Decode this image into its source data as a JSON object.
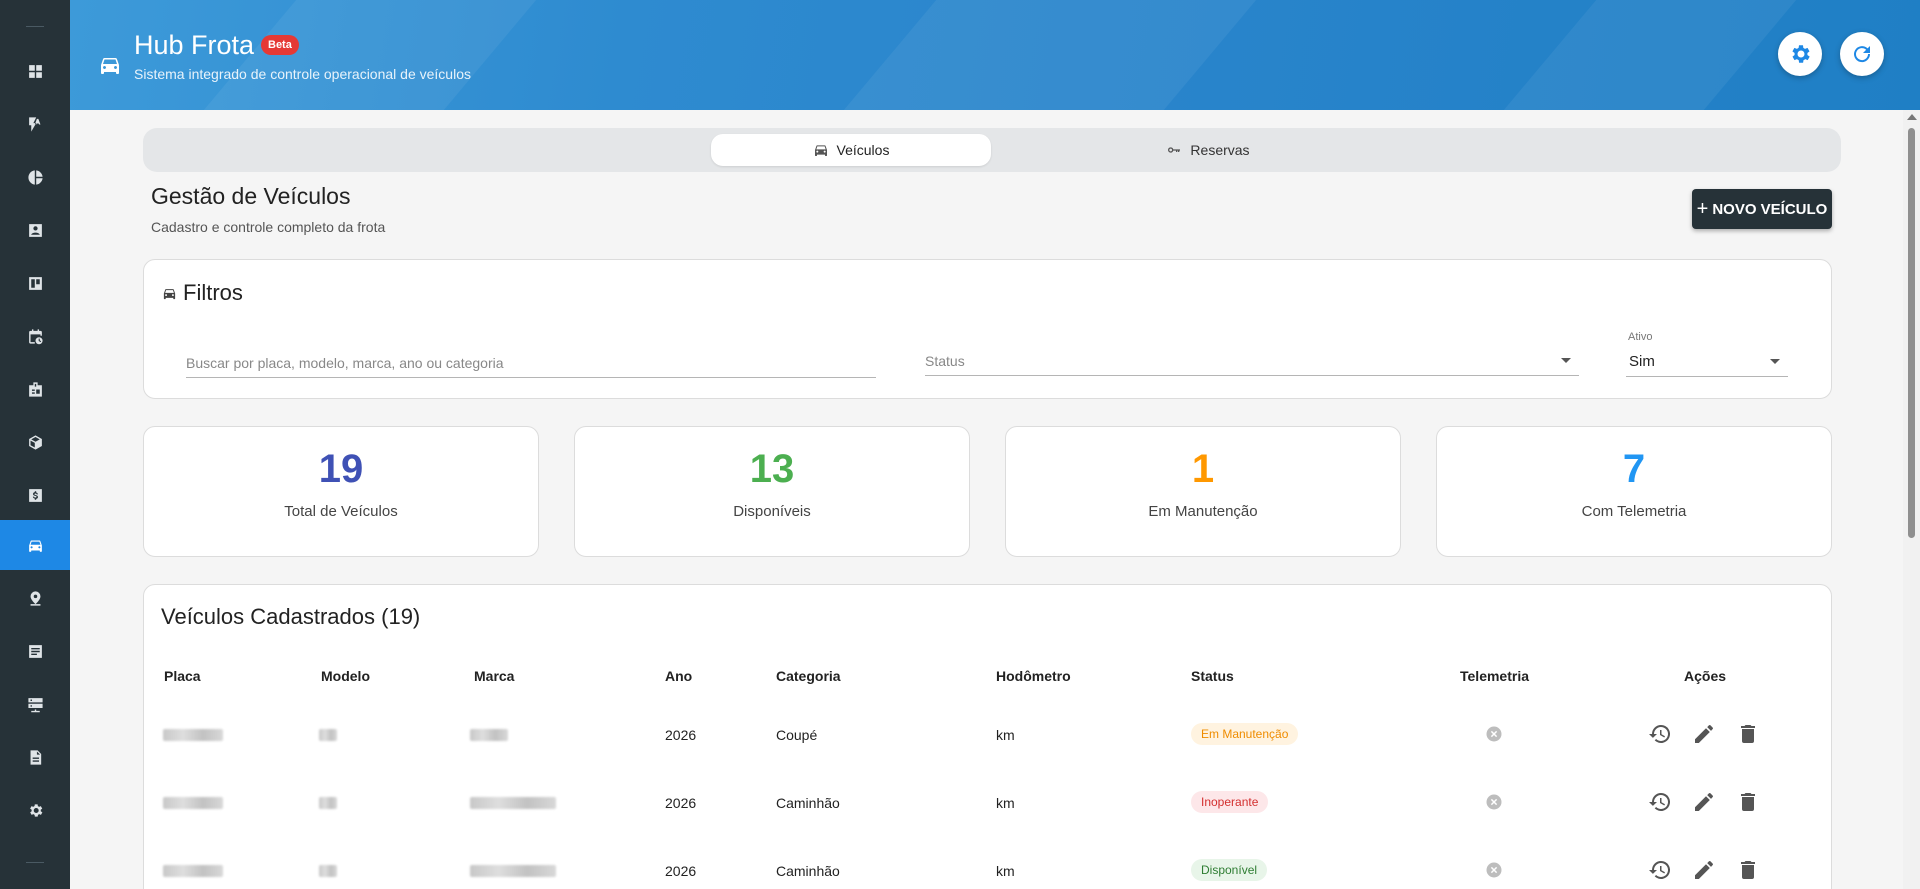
{
  "sidebar": {
    "items": [
      {
        "icon": "dashboard-icon"
      },
      {
        "icon": "flash-icon"
      },
      {
        "icon": "pie-chart-icon"
      },
      {
        "icon": "contact-card-icon"
      },
      {
        "icon": "board-icon"
      },
      {
        "icon": "calendar-clock-icon"
      },
      {
        "icon": "badge-icon"
      },
      {
        "icon": "package-icon"
      },
      {
        "icon": "money-icon"
      },
      {
        "icon": "car-icon",
        "active": true
      },
      {
        "icon": "location-pin-icon"
      },
      {
        "icon": "list-icon"
      },
      {
        "icon": "server-icon"
      },
      {
        "icon": "document-icon"
      },
      {
        "icon": "settings-icon"
      }
    ]
  },
  "header": {
    "title": "Hub Frota",
    "badge": "Beta",
    "subtitle": "Sistema integrado de controle operacional de veículos",
    "icons": [
      "car-icon",
      "settings-icon",
      "refresh-icon"
    ]
  },
  "tabs": [
    {
      "label": "Veículos",
      "icon": "car-icon",
      "active": true
    },
    {
      "label": "Reservas",
      "icon": "key-icon",
      "active": false
    }
  ],
  "page": {
    "title": "Gestão de Veículos",
    "subtitle": "Cadastro e controle completo da frota",
    "new_button": "NOVO VEÍCULO"
  },
  "filters": {
    "title": "Filtros",
    "search_placeholder": "Buscar por placa, modelo, marca, ano ou categoria",
    "status_placeholder": "Status",
    "ativo_label": "Ativo",
    "ativo_value": "Sim"
  },
  "stats": [
    {
      "value": "19",
      "label": "Total de Veículos",
      "color": "#3f51b5"
    },
    {
      "value": "13",
      "label": "Disponíveis",
      "color": "#4caf50"
    },
    {
      "value": "1",
      "label": "Em Manutenção",
      "color": "#ff9800"
    },
    {
      "value": "7",
      "label": "Com Telemetria",
      "color": "#2196f3"
    }
  ],
  "table": {
    "title": "Veículos Cadastrados (19)",
    "columns": [
      "Placa",
      "Modelo",
      "Marca",
      "Ano",
      "Categoria",
      "Hodômetro",
      "Status",
      "Telemetria",
      "Ações"
    ],
    "rows": [
      {
        "ano": "2026",
        "categoria": "Coupé",
        "hodometro": "km",
        "status": "Em Manutenção",
        "status_kind": "maint"
      },
      {
        "ano": "2026",
        "categoria": "Caminhão",
        "hodometro": "km",
        "status": "Inoperante",
        "status_kind": "inop"
      },
      {
        "ano": "2026",
        "categoria": "Caminhão",
        "hodometro": "km",
        "status": "Disponível",
        "status_kind": "disp"
      }
    ]
  }
}
